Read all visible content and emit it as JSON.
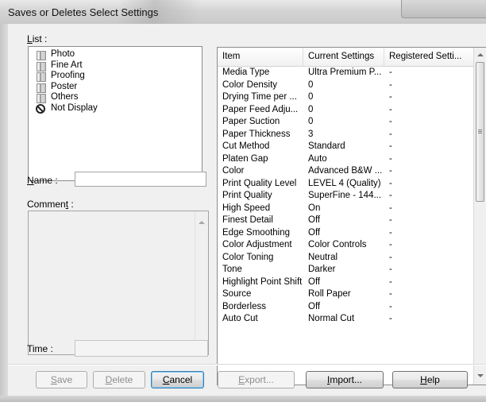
{
  "window": {
    "title": "Saves or Deletes Select Settings"
  },
  "list": {
    "label": "List :",
    "label_accel": "L",
    "label_rest": "ist :",
    "items": [
      {
        "label": "Photo",
        "icon": "folder-icon"
      },
      {
        "label": "Fine Art",
        "icon": "folder-icon"
      },
      {
        "label": "Proofing",
        "icon": "folder-icon"
      },
      {
        "label": "Poster",
        "icon": "folder-icon"
      },
      {
        "label": "Others",
        "icon": "folder-icon"
      },
      {
        "label": "Not Display",
        "icon": "not-display-icon"
      }
    ]
  },
  "name": {
    "label_accel": "N",
    "label_rest": "ame :",
    "value": ""
  },
  "comment": {
    "label_pre": "Commen",
    "label_accel": "t",
    "label_post": " :",
    "value": ""
  },
  "time": {
    "label": "Time :",
    "value": ""
  },
  "table": {
    "columns": [
      "Item",
      "Current Settings",
      "Registered Setti..."
    ],
    "rows": [
      [
        "Media Type",
        "Ultra Premium P...",
        "-"
      ],
      [
        "Color Density",
        "0",
        "-"
      ],
      [
        "Drying Time per ...",
        "0",
        "-"
      ],
      [
        "Paper Feed Adju...",
        "0",
        "-"
      ],
      [
        "Paper Suction",
        "0",
        "-"
      ],
      [
        "Paper Thickness",
        "3",
        "-"
      ],
      [
        "Cut Method",
        "Standard",
        "-"
      ],
      [
        "Platen Gap",
        "Auto",
        "-"
      ],
      [
        "Color",
        "Advanced B&W ...",
        "-"
      ],
      [
        "Print Quality Level",
        "LEVEL 4 (Quality)",
        "-"
      ],
      [
        "Print Quality",
        "SuperFine - 144...",
        "-"
      ],
      [
        "High Speed",
        "On",
        "-"
      ],
      [
        "Finest Detail",
        "Off",
        "-"
      ],
      [
        "Edge Smoothing",
        "Off",
        "-"
      ],
      [
        "Color Adjustment",
        "Color Controls",
        "-"
      ],
      [
        "Color Toning",
        "Neutral",
        "-"
      ],
      [
        "Tone",
        "Darker",
        "-"
      ],
      [
        "Highlight Point Shift",
        "Off",
        "-"
      ],
      [
        "Source",
        "Roll Paper",
        "-"
      ],
      [
        "Borderless",
        "Off",
        "-"
      ],
      [
        "Auto Cut",
        "Normal Cut",
        "-"
      ]
    ]
  },
  "buttons": {
    "save": {
      "accel": "S",
      "rest": "ave"
    },
    "delete": {
      "accel": "D",
      "rest": "elete"
    },
    "cancel": {
      "accel": "C",
      "rest": "ancel"
    },
    "export": {
      "accel": "E",
      "rest": "xport..."
    },
    "import": {
      "accel": "I",
      "rest": "mport..."
    },
    "help": {
      "accel": "H",
      "rest": "elp"
    }
  }
}
